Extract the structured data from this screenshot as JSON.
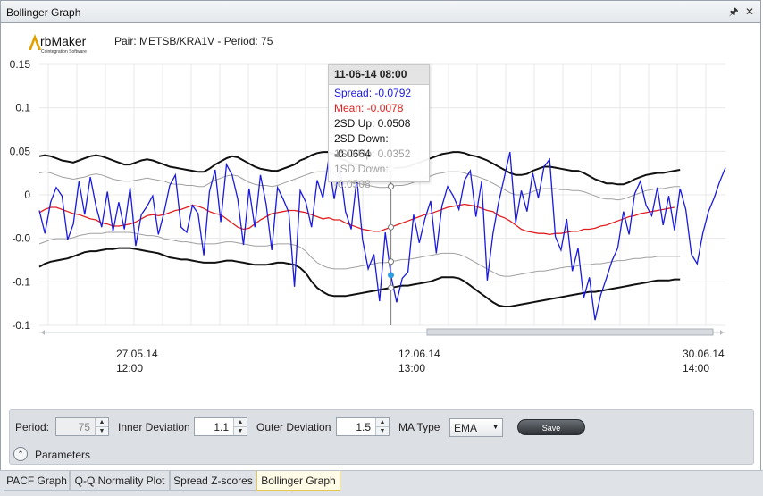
{
  "window": {
    "title": "Bollinger Graph",
    "pin_icon": "pin-icon",
    "close_icon": "close-icon"
  },
  "header": {
    "logo_text": "ArbMaker",
    "logo_sub": "Cointegration Software",
    "pair_info": "Pair: METSB/KRA1V - Period: 75"
  },
  "chart_data": {
    "type": "line",
    "y_ticks": [
      "0.15",
      "0.1",
      "0.05",
      "0",
      "-0.0",
      "-0.1",
      "-0.1"
    ],
    "ylim": [
      -0.1,
      0.15
    ],
    "x_ticks": [
      {
        "date": "27.05.14",
        "time": "12:00"
      },
      {
        "date": "12.06.14",
        "time": "13:00"
      },
      {
        "date": "30.06.14",
        "time": "14:00"
      }
    ],
    "grid": true,
    "colors": {
      "spread": "#1a1ae0",
      "mean": "#e02020",
      "sd2": "#111111",
      "sd1": "#a0a0a0"
    },
    "series": [
      {
        "name": "Spread",
        "values": [
          0.01,
          -0.012,
          0.018,
          0.032,
          0.024,
          -0.018,
          -0.003,
          0.038,
          0.006,
          0.042,
          0.014,
          -0.006,
          0.028,
          -0.01,
          0.018,
          -0.008,
          0.032,
          -0.024,
          0.006,
          0.014,
          0.024,
          -0.013,
          0.008,
          0.034,
          0.044,
          -0.006,
          -0.011,
          0.015,
          0.007,
          -0.033,
          0.028,
          0.049,
          -0.001,
          0.054,
          0.044,
          0.021,
          -0.023,
          0.031,
          -0.006,
          0.044,
          0.016,
          -0.028,
          0.032,
          0.021,
          0.008,
          -0.063,
          0.029,
          0.018,
          -0.006,
          0.039,
          0.022,
          0.058,
          0.021,
          0.052,
          0.009,
          -0.008,
          0.041,
          -0.018,
          -0.046,
          -0.032,
          -0.077,
          -0.011,
          -0.052,
          -0.078,
          -0.055,
          -0.049,
          0.006,
          -0.021,
          0.002,
          0.019,
          -0.031,
          0.014,
          0.033,
          0.024,
          0.011,
          0.039,
          0.048,
          0.004,
          0.038,
          -0.057,
          -0.012,
          0.018,
          0.042,
          0.066,
          -0.002,
          0.029,
          0.009,
          0.046,
          0.022,
          0.052,
          0.059,
          -0.015,
          -0.028,
          0.002,
          -0.048,
          -0.026,
          -0.074,
          -0.054,
          -0.095,
          -0.071,
          -0.055,
          -0.038,
          -0.026,
          0.009,
          -0.013,
          0.026,
          0.038,
          0.015,
          0.005,
          0.032,
          -0.004,
          0.024,
          -0.009,
          0.031,
          0.011,
          -0.032,
          -0.041,
          -0.012,
          0.009,
          0.022,
          0.038,
          0.051
        ]
      },
      {
        "name": "Mean",
        "values": [
          0.008,
          0.011,
          0.013,
          0.013,
          0.011,
          0.009,
          0.007,
          0.006,
          0.004,
          0.002,
          0.001,
          -0.002,
          -0.003,
          -0.005,
          -0.005,
          -0.004,
          -0.003,
          -0.001,
          0.002,
          0.005,
          0.006,
          0.005,
          0.006,
          0.008,
          0.01,
          0.011,
          0.013,
          0.015,
          0.014,
          0.012,
          0.009,
          0.007,
          0.006,
          0.002,
          -0.002,
          -0.006,
          -0.008,
          -0.007,
          -0.003,
          0.001,
          0.004,
          0.007,
          0.008,
          0.009,
          0.01,
          0.01,
          0.009,
          0.008,
          0.006,
          0.004,
          0.002,
          0.003,
          0.001,
          0.001,
          -0.002,
          -0.004,
          -0.006,
          -0.008,
          -0.009,
          -0.01,
          -0.01,
          -0.008,
          -0.006,
          -0.004,
          -0.002,
          0.0,
          0.002,
          0.004,
          0.006,
          0.007,
          0.009,
          0.011,
          0.013,
          0.014,
          0.015,
          0.016,
          0.015,
          0.014,
          0.012,
          0.01,
          0.009,
          0.005,
          0.003,
          0.0,
          -0.004,
          -0.008,
          -0.01,
          -0.011,
          -0.012,
          -0.012,
          -0.013,
          -0.012,
          -0.012,
          -0.011,
          -0.01,
          -0.01,
          -0.008,
          -0.008,
          -0.007,
          -0.005,
          -0.004,
          -0.002,
          0.0,
          0.002,
          0.004,
          0.005,
          0.007,
          0.008,
          0.009,
          0.01,
          0.011,
          0.012,
          0.013
        ]
      },
      {
        "name": "2SD Up",
        "values": [
          0.062,
          0.063,
          0.062,
          0.06,
          0.058,
          0.057,
          0.056,
          0.058,
          0.06,
          0.062,
          0.063,
          0.062,
          0.06,
          0.058,
          0.056,
          0.054,
          0.054,
          0.056,
          0.058,
          0.059,
          0.058,
          0.056,
          0.054,
          0.052,
          0.051,
          0.05,
          0.049,
          0.048,
          0.047,
          0.047,
          0.05,
          0.054,
          0.057,
          0.06,
          0.062,
          0.061,
          0.058,
          0.055,
          0.052,
          0.05,
          0.049,
          0.048,
          0.048,
          0.05,
          0.052,
          0.054,
          0.058,
          0.06,
          0.063,
          0.065,
          0.066,
          0.066,
          0.064,
          0.06,
          0.058,
          0.055,
          0.054,
          0.053,
          0.052,
          0.051,
          0.05,
          0.049,
          0.05,
          0.051,
          0.051,
          0.052,
          0.054,
          0.056,
          0.058,
          0.06,
          0.062,
          0.064,
          0.065,
          0.066,
          0.066,
          0.065,
          0.063,
          0.062,
          0.06,
          0.058,
          0.055,
          0.052,
          0.049,
          0.046,
          0.044,
          0.044,
          0.045,
          0.048,
          0.05,
          0.052,
          0.052,
          0.051,
          0.05,
          0.049,
          0.048,
          0.048,
          0.046,
          0.043,
          0.04,
          0.038,
          0.036,
          0.036,
          0.035,
          0.035,
          0.037,
          0.04,
          0.042,
          0.044,
          0.045,
          0.046,
          0.046,
          0.047,
          0.048,
          0.049
        ]
      },
      {
        "name": "2SD Down",
        "values": [
          -0.044,
          -0.041,
          -0.039,
          -0.038,
          -0.037,
          -0.036,
          -0.034,
          -0.032,
          -0.03,
          -0.029,
          -0.029,
          -0.028,
          -0.027,
          -0.027,
          -0.026,
          -0.026,
          -0.026,
          -0.027,
          -0.028,
          -0.029,
          -0.03,
          -0.031,
          -0.033,
          -0.035,
          -0.036,
          -0.037,
          -0.037,
          -0.038,
          -0.039,
          -0.04,
          -0.04,
          -0.04,
          -0.039,
          -0.038,
          -0.038,
          -0.039,
          -0.04,
          -0.041,
          -0.042,
          -0.042,
          -0.042,
          -0.041,
          -0.04,
          -0.04,
          -0.041,
          -0.042,
          -0.045,
          -0.05,
          -0.058,
          -0.064,
          -0.068,
          -0.071,
          -0.072,
          -0.072,
          -0.072,
          -0.071,
          -0.07,
          -0.069,
          -0.068,
          -0.067,
          -0.066,
          -0.065,
          -0.064,
          -0.063,
          -0.062,
          -0.062,
          -0.061,
          -0.06,
          -0.059,
          -0.058,
          -0.056,
          -0.054,
          -0.054,
          -0.054,
          -0.055,
          -0.058,
          -0.062,
          -0.066,
          -0.07,
          -0.074,
          -0.078,
          -0.081,
          -0.082,
          -0.082,
          -0.081,
          -0.08,
          -0.079,
          -0.078,
          -0.077,
          -0.076,
          -0.075,
          -0.074,
          -0.073,
          -0.072,
          -0.071,
          -0.07,
          -0.069,
          -0.068,
          -0.068,
          -0.067,
          -0.066,
          -0.065,
          -0.064,
          -0.063,
          -0.062,
          -0.061,
          -0.06,
          -0.059,
          -0.058,
          -0.057,
          -0.057,
          -0.057,
          -0.056,
          -0.056
        ]
      },
      {
        "name": "1SD Up",
        "values": [
          0.046,
          0.047,
          0.046,
          0.044,
          0.042,
          0.041,
          0.04,
          0.041,
          0.042,
          0.044,
          0.045,
          0.044,
          0.042,
          0.04,
          0.039,
          0.038,
          0.038,
          0.039,
          0.04,
          0.041,
          0.04,
          0.039,
          0.038,
          0.036,
          0.035,
          0.035,
          0.034,
          0.034,
          0.033,
          0.033,
          0.036,
          0.039,
          0.041,
          0.043,
          0.044,
          0.043,
          0.04,
          0.037,
          0.035,
          0.034,
          0.034,
          0.033,
          0.034,
          0.036,
          0.038,
          0.04,
          0.042,
          0.044,
          0.046,
          0.047,
          0.047,
          0.047,
          0.045,
          0.042,
          0.04,
          0.037,
          0.036,
          0.035,
          0.034,
          0.033,
          0.032,
          0.032,
          0.033,
          0.034,
          0.034,
          0.035,
          0.037,
          0.039,
          0.041,
          0.043,
          0.045,
          0.046,
          0.047,
          0.047,
          0.047,
          0.046,
          0.044,
          0.043,
          0.041,
          0.039,
          0.036,
          0.033,
          0.03,
          0.027,
          0.025,
          0.025,
          0.026,
          0.028,
          0.03,
          0.031,
          0.031,
          0.031,
          0.03,
          0.03,
          0.029,
          0.029,
          0.028,
          0.026,
          0.024,
          0.022,
          0.021,
          0.021,
          0.02,
          0.021,
          0.023,
          0.025,
          0.027,
          0.029,
          0.03,
          0.031,
          0.031,
          0.032,
          0.033,
          0.033
        ]
      },
      {
        "name": "1SD Down",
        "values": [
          -0.022,
          -0.02,
          -0.018,
          -0.017,
          -0.017,
          -0.017,
          -0.016,
          -0.014,
          -0.013,
          -0.012,
          -0.012,
          -0.012,
          -0.011,
          -0.011,
          -0.011,
          -0.011,
          -0.011,
          -0.012,
          -0.013,
          -0.014,
          -0.014,
          -0.015,
          -0.017,
          -0.018,
          -0.019,
          -0.02,
          -0.02,
          -0.021,
          -0.022,
          -0.022,
          -0.022,
          -0.022,
          -0.021,
          -0.02,
          -0.02,
          -0.021,
          -0.022,
          -0.023,
          -0.024,
          -0.024,
          -0.024,
          -0.023,
          -0.022,
          -0.022,
          -0.022,
          -0.023,
          -0.025,
          -0.029,
          -0.035,
          -0.04,
          -0.043,
          -0.045,
          -0.046,
          -0.046,
          -0.046,
          -0.045,
          -0.044,
          -0.043,
          -0.042,
          -0.041,
          -0.04,
          -0.04,
          -0.039,
          -0.038,
          -0.037,
          -0.037,
          -0.036,
          -0.035,
          -0.034,
          -0.033,
          -0.032,
          -0.031,
          -0.031,
          -0.031,
          -0.032,
          -0.034,
          -0.037,
          -0.04,
          -0.043,
          -0.046,
          -0.049,
          -0.052,
          -0.053,
          -0.053,
          -0.052,
          -0.051,
          -0.05,
          -0.049,
          -0.048,
          -0.048,
          -0.047,
          -0.046,
          -0.045,
          -0.044,
          -0.044,
          -0.043,
          -0.042,
          -0.042,
          -0.041,
          -0.041,
          -0.04,
          -0.039,
          -0.038,
          -0.038,
          -0.037,
          -0.036,
          -0.036,
          -0.035,
          -0.035,
          -0.034,
          -0.034,
          -0.034,
          -0.034,
          -0.034
        ]
      }
    ],
    "cursor_index": 62,
    "tooltip": {
      "date": "11-06-14 08:00",
      "spread": "Spread: -0.0792",
      "mean": "Mean: -0.0078",
      "sd2_up": "2SD Up: 0.0508",
      "sd2_down": "2SD Down: -0.0664",
      "sd1_up": "1SD Up: 0.0352",
      "sd1_down": "1SD Down: -0.0508"
    }
  },
  "parameters": {
    "period_label": "Period:",
    "period_value": "75",
    "inner_label": "Inner Deviation",
    "inner_value": "1.1",
    "outer_label": "Outer Deviation",
    "outer_value": "1.5",
    "ma_label": "MA Type",
    "ma_value": "EMA",
    "save_label": "Save",
    "expander_label": "Parameters"
  },
  "tabs": [
    {
      "label": "PACF Graph",
      "active": false
    },
    {
      "label": "Q-Q Normality Plot",
      "active": false
    },
    {
      "label": "Spread Z-scores",
      "active": false
    },
    {
      "label": "Bollinger Graph",
      "active": true
    }
  ]
}
